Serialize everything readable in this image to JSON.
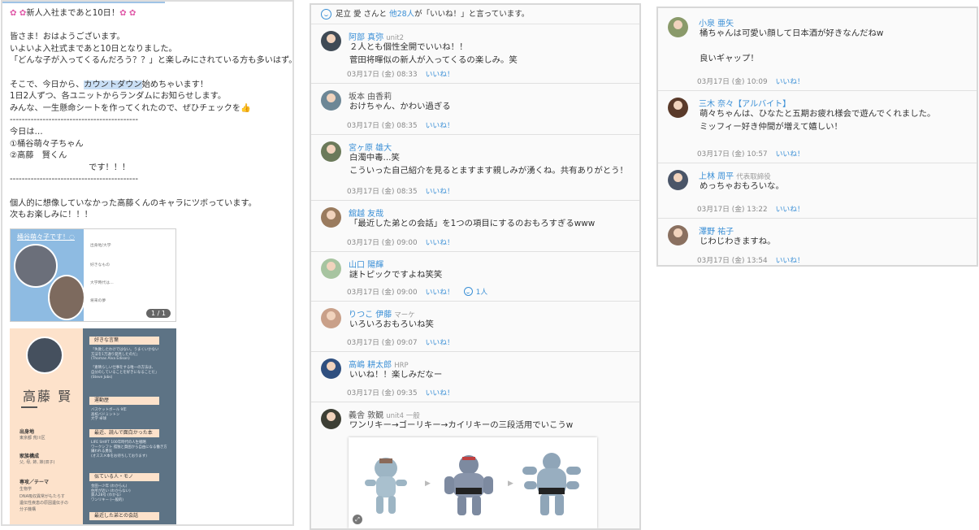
{
  "post": {
    "lines": [
      {
        "pre": "✿ ✿",
        "text": "新人入社まであと10日！",
        "post": "✿ ✿"
      },
      {
        "text": ""
      },
      {
        "text": "皆さま！おはようございます。"
      },
      {
        "text": "いよいよ入社式まであと10日となりました。"
      },
      {
        "text": "「どんな子が入ってくるんだろう？？」と楽しみにされている方も多いはず。"
      },
      {
        "text": ""
      },
      {
        "pre_text": "そこで、今日から、",
        "highlight": "カウントダウン",
        "post_text": "始めちゃいます！"
      },
      {
        "text": "1日2人ずつ、各ユニットからランダムにお知らせします。"
      },
      {
        "text": "みんな、一生懸命シートを作ってくれたので、ぜひチェックを",
        "fire": "👍"
      },
      {
        "text": "-------------------------------------------"
      },
      {
        "text": "今日は…"
      },
      {
        "text": "①桶谷萌々子ちゃん"
      },
      {
        "text": "②高藤　賢くん"
      },
      {
        "text": "                              です！！！"
      },
      {
        "text": "-------------------------------------------"
      },
      {
        "text": ""
      },
      {
        "text": "個人的に想像していなかった高藤くんのキャラにツボっています。"
      },
      {
        "text": "次もお楽しみに！！！"
      }
    ],
    "image_card": {
      "title": "桶谷萌々子です！◌",
      "rows": [
        "出身地/大学",
        "好きなもの",
        "大学時代は…",
        "将来の夢"
      ],
      "counter": "1 / 1"
    },
    "profile_card": {
      "name": "高藤 賢",
      "labels": [
        "出身地",
        "家族構成",
        "専攻／テーマ"
      ],
      "small": [
        "東京都 荒川区",
        "父, 母, 姉, 妹(双子)",
        "生物学",
        "DNA吸収異常がもたらす",
        "遺伝性疾患の原因遺伝子の",
        "分子機構"
      ],
      "tags": [
        "好きな言葉",
        "運動歴",
        "最近、読んで面白かった本",
        "似ている人・モノ",
        "最近した弟との会話"
      ],
      "texts": [
        "「失敗したわけではない。うまくいかない\n方法を1万通り発見したのだ」\n(Thomas Alva Edison)\n\n「素晴らしい仕事をする唯一の方法は、\n自分のしていることを好きになることだ」\n(Steve Jobs)",
        "バスケットボール 9年\n高校バドミントン\n大学 卓球",
        "LIFE SHIFT 100年時代の人生戦略\nワークシフト 孤独と貧困から自由になる働き方\n嫌われる勇気\n(オススメ本をお待ちしております)",
        "金田一少年 (わからん)\n住所が近い (わからない)\n鉄人28号 (わかる)\nワンリキー (一般的)",
        ""
      ]
    }
  },
  "likes_header": {
    "prefix": "足立 愛",
    "middle": " さんと ",
    "others": "他28人",
    "suffix": "が「いいね！」と言っています。"
  },
  "comments_mid": [
    {
      "name": "阿部 真弥",
      "role": "unit2",
      "name_linked": true,
      "avatar_color": "#3f4a55",
      "text": "２人とも個性全開でいいね！！\n菅田将暉似の新人が入ってくるの楽しみ。笑",
      "time": "03月17日 (金) 08:33",
      "like": "いいね！"
    },
    {
      "name": "坂本 由香莉",
      "role": "",
      "name_linked": false,
      "avatar_color": "#6d8796",
      "text": "おけちゃん、かわい過ぎる",
      "time": "03月17日 (金) 08:35",
      "like": "いいね！"
    },
    {
      "name": "宮ヶ原 雄大",
      "role": "",
      "name_linked": true,
      "avatar_color": "#6b7a5a",
      "text": "白濁中毒...笑\nこういった自己紹介を見るとますます親しみが湧くね。共有ありがとう！",
      "time": "03月17日 (金) 08:35",
      "like": "いいね！"
    },
    {
      "name": "舘越 友哉",
      "role": "",
      "name_linked": true,
      "avatar_color": "#9a7b5e",
      "text": "「最近した弟との会話」を1つの項目にするのおもろすぎるwww",
      "time": "03月17日 (金) 09:00",
      "like": "いいね！"
    },
    {
      "name": "山口 陽輝",
      "role": "",
      "name_linked": true,
      "avatar_color": "#a7c4a0",
      "text": "謎トピックですよね笑笑",
      "time": "03月17日 (金) 09:00",
      "like": "いいね！",
      "like_count": "1人"
    },
    {
      "name": "りつこ 伊藤",
      "role": "マーケ",
      "name_linked": true,
      "avatar_color": "#c9a089",
      "text": "いろいろおもろいね笑",
      "time": "03月17日 (金) 09:07",
      "like": "いいね！"
    },
    {
      "name": "高嶋 耕太郎",
      "role": "HRP",
      "name_linked": true,
      "avatar_color": "#2f4f7f",
      "text": "いいね！！楽しみだなー",
      "time": "03月17日 (金) 09:35",
      "like": "いいね！"
    },
    {
      "name": "義舎 敦観",
      "role": "unit4 一般",
      "name_linked": false,
      "avatar_color": "#3d3f35",
      "text": "ワンリキー→ゴーリキー→カイリキーの三段活用でいこうw",
      "time": "",
      "like": ""
    }
  ],
  "comments_right": [
    {
      "name": "小泉 亜矢",
      "role": "",
      "name_linked": true,
      "avatar_color": "#8a9a6a",
      "text": "桶ちゃんは可愛い顔して日本酒が好きなんだねw\n\n良いギャップ！",
      "time": "03月17日 (金) 10:09",
      "like": "いいね！"
    },
    {
      "name": "三木 奈々【アルバイト】",
      "role": "",
      "name_linked": true,
      "avatar_color": "#5a3a2a",
      "text": "萌々ちゃんは、ひなたと五期お疲れ様会で遊んでくれました。\nミッフィー好き仲間が増えて嬉しい！",
      "time": "03月17日 (金) 10:57",
      "like": "いいね！"
    },
    {
      "name": "上林 周平",
      "role": "代表取締役",
      "name_linked": true,
      "avatar_color": "#4a5568",
      "text": "めっちゃおもろいな。",
      "time": "03月17日 (金) 13:22",
      "like": "いいね！"
    },
    {
      "name": "澤野 祐子",
      "role": "",
      "name_linked": true,
      "avatar_color": "#8a7060",
      "text": "じわじわきますね。",
      "time": "03月17日 (金) 13:54",
      "like": "いいね！"
    }
  ],
  "colors": {
    "link": "#3a8fd6",
    "border": "#d8d8d8",
    "flower": "#e05aa8"
  },
  "icons": [
    "smile-icon",
    "flower-icon",
    "thumbs-up-icon"
  ]
}
